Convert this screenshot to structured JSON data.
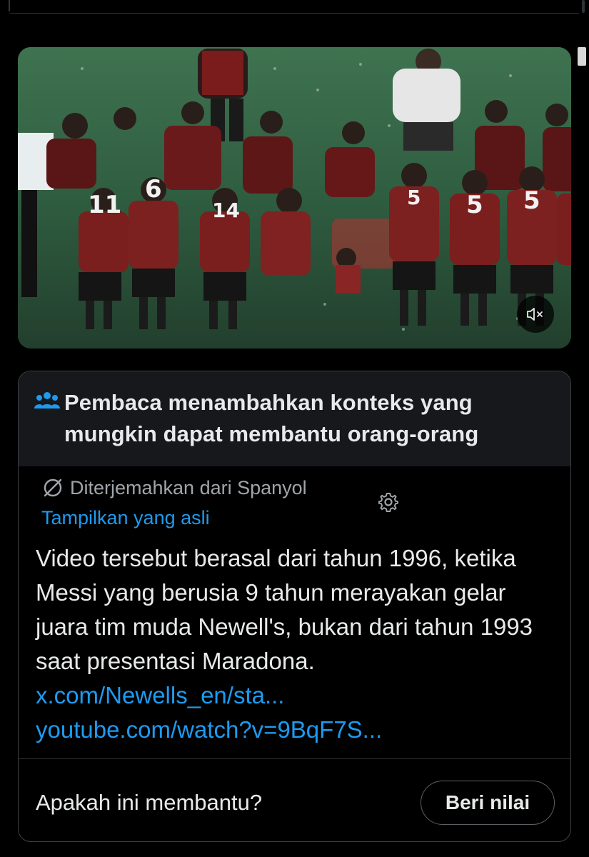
{
  "media": {
    "mute_label": "",
    "jersey_numbers": [
      "11",
      "6",
      "14",
      "5",
      "5",
      "5"
    ]
  },
  "note": {
    "title": "Pembaca menambahkan konteks yang mungkin dapat membantu orang-orang",
    "translated_from": "Diterjemahkan dari Spanyol",
    "show_original": "Tampilkan yang asli",
    "body_text": "Video tersebut berasal dari tahun 1996, ketika Messi yang berusia 9 tahun merayakan gelar juara tim muda Newell's, bukan dari tahun 1993 saat presentasi Maradona.",
    "link1": "x.com/Newells_en/sta...",
    "link2": "youtube.com/watch?v=9BqF7S...",
    "helpful_question": "Apakah ini membantu?",
    "rate_button": "Beri nilai"
  },
  "colors": {
    "background": "#000000",
    "header_bg": "#16181c",
    "link": "#1d9bf0",
    "text": "#e7e9ea",
    "muted": "#a0a5aa"
  },
  "icons": {
    "note_header": "people-icon",
    "translate": "slash-circle-icon",
    "settings": "gear-icon",
    "mute": "speaker-muted-icon"
  }
}
